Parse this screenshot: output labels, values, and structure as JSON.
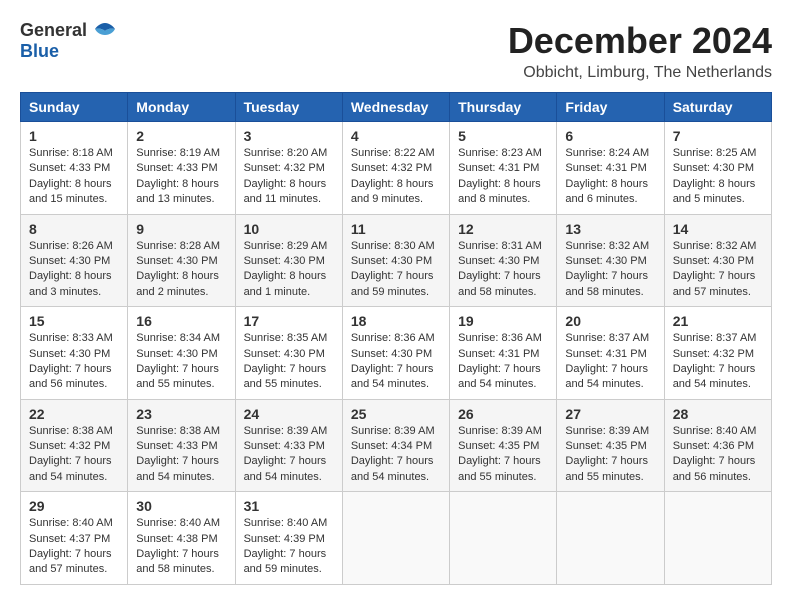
{
  "logo": {
    "general": "General",
    "blue": "Blue"
  },
  "title": "December 2024",
  "subtitle": "Obbicht, Limburg, The Netherlands",
  "headers": [
    "Sunday",
    "Monday",
    "Tuesday",
    "Wednesday",
    "Thursday",
    "Friday",
    "Saturday"
  ],
  "weeks": [
    [
      {
        "day": "1",
        "sunrise": "8:18 AM",
        "sunset": "4:33 PM",
        "daylight": "8 hours and 15 minutes."
      },
      {
        "day": "2",
        "sunrise": "8:19 AM",
        "sunset": "4:33 PM",
        "daylight": "8 hours and 13 minutes."
      },
      {
        "day": "3",
        "sunrise": "8:20 AM",
        "sunset": "4:32 PM",
        "daylight": "8 hours and 11 minutes."
      },
      {
        "day": "4",
        "sunrise": "8:22 AM",
        "sunset": "4:32 PM",
        "daylight": "8 hours and 9 minutes."
      },
      {
        "day": "5",
        "sunrise": "8:23 AM",
        "sunset": "4:31 PM",
        "daylight": "8 hours and 8 minutes."
      },
      {
        "day": "6",
        "sunrise": "8:24 AM",
        "sunset": "4:31 PM",
        "daylight": "8 hours and 6 minutes."
      },
      {
        "day": "7",
        "sunrise": "8:25 AM",
        "sunset": "4:30 PM",
        "daylight": "8 hours and 5 minutes."
      }
    ],
    [
      {
        "day": "8",
        "sunrise": "8:26 AM",
        "sunset": "4:30 PM",
        "daylight": "8 hours and 3 minutes."
      },
      {
        "day": "9",
        "sunrise": "8:28 AM",
        "sunset": "4:30 PM",
        "daylight": "8 hours and 2 minutes."
      },
      {
        "day": "10",
        "sunrise": "8:29 AM",
        "sunset": "4:30 PM",
        "daylight": "8 hours and 1 minute."
      },
      {
        "day": "11",
        "sunrise": "8:30 AM",
        "sunset": "4:30 PM",
        "daylight": "7 hours and 59 minutes."
      },
      {
        "day": "12",
        "sunrise": "8:31 AM",
        "sunset": "4:30 PM",
        "daylight": "7 hours and 58 minutes."
      },
      {
        "day": "13",
        "sunrise": "8:32 AM",
        "sunset": "4:30 PM",
        "daylight": "7 hours and 58 minutes."
      },
      {
        "day": "14",
        "sunrise": "8:32 AM",
        "sunset": "4:30 PM",
        "daylight": "7 hours and 57 minutes."
      }
    ],
    [
      {
        "day": "15",
        "sunrise": "8:33 AM",
        "sunset": "4:30 PM",
        "daylight": "7 hours and 56 minutes."
      },
      {
        "day": "16",
        "sunrise": "8:34 AM",
        "sunset": "4:30 PM",
        "daylight": "7 hours and 55 minutes."
      },
      {
        "day": "17",
        "sunrise": "8:35 AM",
        "sunset": "4:30 PM",
        "daylight": "7 hours and 55 minutes."
      },
      {
        "day": "18",
        "sunrise": "8:36 AM",
        "sunset": "4:30 PM",
        "daylight": "7 hours and 54 minutes."
      },
      {
        "day": "19",
        "sunrise": "8:36 AM",
        "sunset": "4:31 PM",
        "daylight": "7 hours and 54 minutes."
      },
      {
        "day": "20",
        "sunrise": "8:37 AM",
        "sunset": "4:31 PM",
        "daylight": "7 hours and 54 minutes."
      },
      {
        "day": "21",
        "sunrise": "8:37 AM",
        "sunset": "4:32 PM",
        "daylight": "7 hours and 54 minutes."
      }
    ],
    [
      {
        "day": "22",
        "sunrise": "8:38 AM",
        "sunset": "4:32 PM",
        "daylight": "7 hours and 54 minutes."
      },
      {
        "day": "23",
        "sunrise": "8:38 AM",
        "sunset": "4:33 PM",
        "daylight": "7 hours and 54 minutes."
      },
      {
        "day": "24",
        "sunrise": "8:39 AM",
        "sunset": "4:33 PM",
        "daylight": "7 hours and 54 minutes."
      },
      {
        "day": "25",
        "sunrise": "8:39 AM",
        "sunset": "4:34 PM",
        "daylight": "7 hours and 54 minutes."
      },
      {
        "day": "26",
        "sunrise": "8:39 AM",
        "sunset": "4:35 PM",
        "daylight": "7 hours and 55 minutes."
      },
      {
        "day": "27",
        "sunrise": "8:39 AM",
        "sunset": "4:35 PM",
        "daylight": "7 hours and 55 minutes."
      },
      {
        "day": "28",
        "sunrise": "8:40 AM",
        "sunset": "4:36 PM",
        "daylight": "7 hours and 56 minutes."
      }
    ],
    [
      {
        "day": "29",
        "sunrise": "8:40 AM",
        "sunset": "4:37 PM",
        "daylight": "7 hours and 57 minutes."
      },
      {
        "day": "30",
        "sunrise": "8:40 AM",
        "sunset": "4:38 PM",
        "daylight": "7 hours and 58 minutes."
      },
      {
        "day": "31",
        "sunrise": "8:40 AM",
        "sunset": "4:39 PM",
        "daylight": "7 hours and 59 minutes."
      },
      null,
      null,
      null,
      null
    ]
  ]
}
